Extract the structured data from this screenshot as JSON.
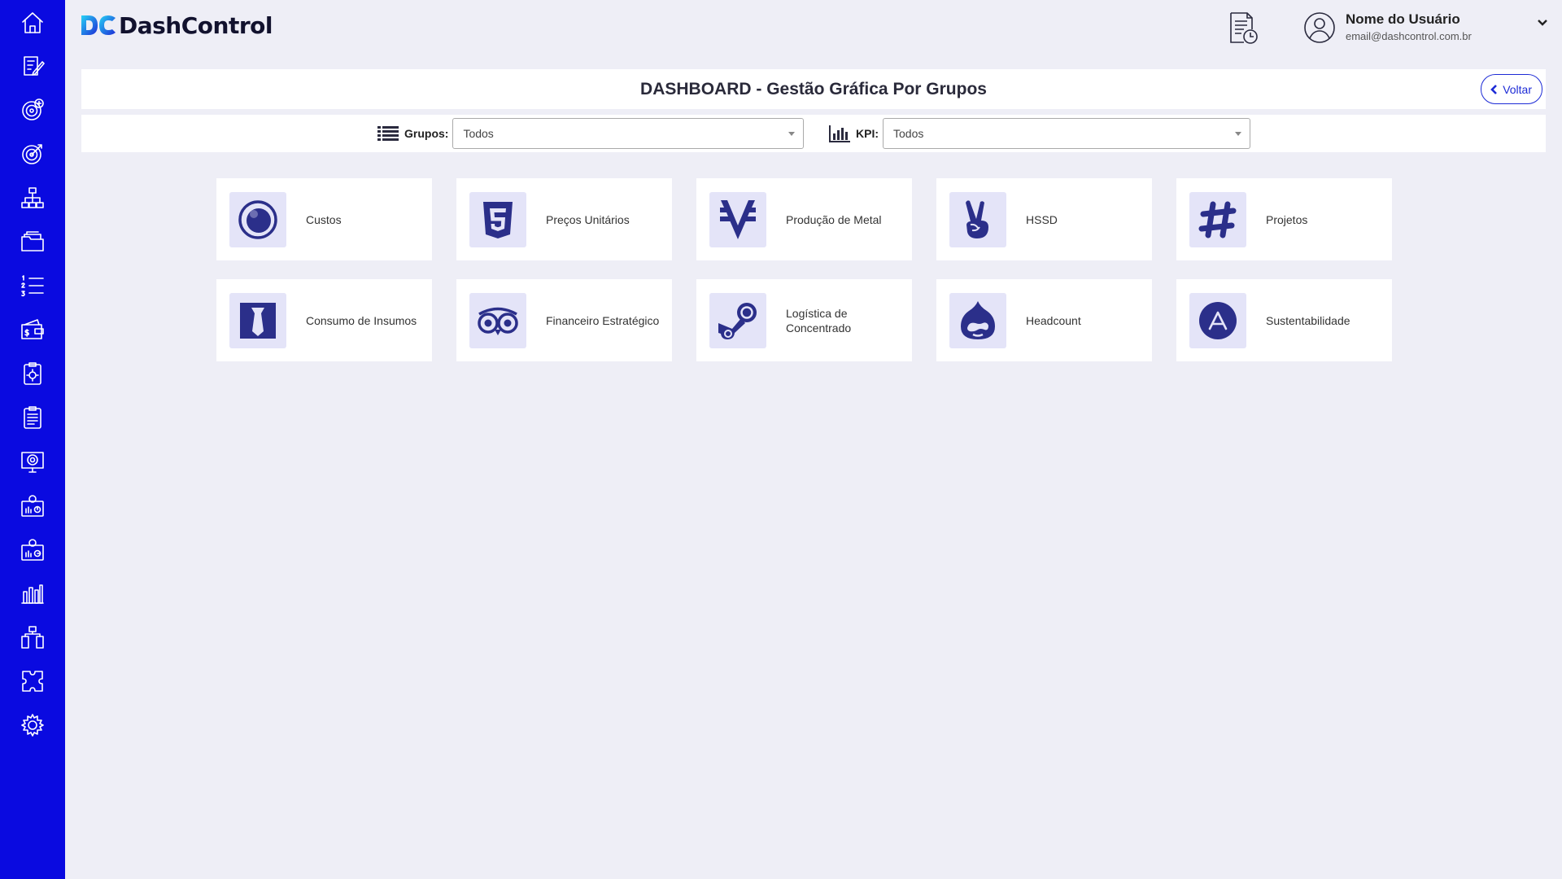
{
  "brand": {
    "name": "DashControl",
    "logo_mark": "DC"
  },
  "sidebar": {
    "items": [
      {
        "icon": "home-icon"
      },
      {
        "icon": "edit-document-icon"
      },
      {
        "icon": "target-add-icon"
      },
      {
        "icon": "target-icon"
      },
      {
        "icon": "org-chart-icon"
      },
      {
        "icon": "folders-icon"
      },
      {
        "icon": "numbered-list-icon"
      },
      {
        "icon": "wallet-icon"
      },
      {
        "icon": "clipboard-gear-icon"
      },
      {
        "icon": "clipboard-list-icon"
      },
      {
        "icon": "presentation-target-icon"
      },
      {
        "icon": "dashboard-report-icon"
      },
      {
        "icon": "dashboard-report-alt-icon"
      },
      {
        "icon": "bar-chart-icon"
      },
      {
        "icon": "flow-icon"
      },
      {
        "icon": "puzzle-icon"
      },
      {
        "icon": "settings-icon"
      }
    ]
  },
  "header": {
    "report_icon": "report-clock-icon",
    "user": {
      "name": "Nome do Usuário",
      "email": "email@dashcontrol.com.br"
    }
  },
  "page": {
    "title": "DASHBOARD - Gestão Gráfica Por Grupos",
    "back_label": "Voltar"
  },
  "filters": {
    "groups": {
      "label": "Grupos:",
      "value": "Todos"
    },
    "kpi": {
      "label": "KPI:",
      "value": "Todos"
    }
  },
  "cards": [
    {
      "label": "Custos",
      "icon": "ring-icon"
    },
    {
      "label": "Preços Unitários",
      "icon": "html5-icon"
    },
    {
      "label": "Produção de Metal",
      "icon": "viacoin-icon"
    },
    {
      "label": "HSSD",
      "icon": "peace-hand-icon"
    },
    {
      "label": "Projetos",
      "icon": "hashtag-icon"
    },
    {
      "label": "Consumo de Insumos",
      "icon": "tie-icon"
    },
    {
      "label": "Financeiro Estratégico",
      "icon": "tripadvisor-icon"
    },
    {
      "label": "Logística de Concentrado",
      "icon": "steam-icon"
    },
    {
      "label": "Headcount",
      "icon": "drupal-icon"
    },
    {
      "label": "Sustentabilidade",
      "icon": "app-store-icon"
    }
  ],
  "colors": {
    "sidebar": "#0a0ae0",
    "accent": "#1d2bd6",
    "icon": "#2b2f8a",
    "icon_bg": "#e4e4f8",
    "background": "#eeeef6"
  }
}
